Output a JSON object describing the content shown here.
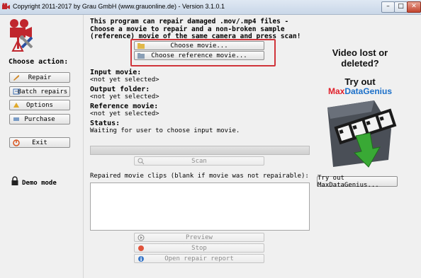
{
  "window": {
    "title": "Copyright 2011-2017 by Grau GmbH (www.grauonline.de) - Version 3.1.0.1",
    "min": "–",
    "max": "□",
    "close": "✕"
  },
  "sidebar": {
    "heading": "Choose action:",
    "items": [
      {
        "label": "Repair",
        "icon": "wrench-icon"
      },
      {
        "label": "Batch repairs",
        "icon": "batch-icon"
      },
      {
        "label": "Options",
        "icon": "options-icon"
      },
      {
        "label": "Purchase",
        "icon": "cart-icon"
      }
    ],
    "exit_label": "Exit",
    "demo_label": "Demo mode"
  },
  "main": {
    "intro": "This program can repair damaged .mov/.mp4 files - Choose a movie to repair and a non-broken sample (reference) movie of the same camera and press scan!",
    "choose_movie": "Choose movie...",
    "choose_reference": "Choose reference movie...",
    "input_movie_label": "Input movie:",
    "input_movie_value": "<not yet selected>",
    "output_folder_label": "Output folder:",
    "output_folder_value": "<not yet selected>",
    "reference_movie_label": "Reference movie:",
    "reference_movie_value": "<not yet selected>",
    "status_label": "Status:",
    "status_value": "Waiting for user to choose input movie.",
    "progress": 0,
    "scan_label": "Scan",
    "repaired_label": "Repaired movie clips (blank if movie was not repairable):",
    "preview_label": "Preview",
    "stop_label": "Stop",
    "open_report_label": "Open repair report"
  },
  "ad": {
    "title_line1": "Video lost or",
    "title_line2": "deleted?",
    "try_out": "Try out",
    "brand_part1": "Max",
    "brand_part2": "Data",
    "brand_part3": "Genius",
    "button_label": "Try out MaxDataGenius..."
  },
  "colors": {
    "accent_red": "#d0343a",
    "brand_red": "#e0202b",
    "brand_blue": "#1b6fc8",
    "arrow_green": "#39a935"
  }
}
